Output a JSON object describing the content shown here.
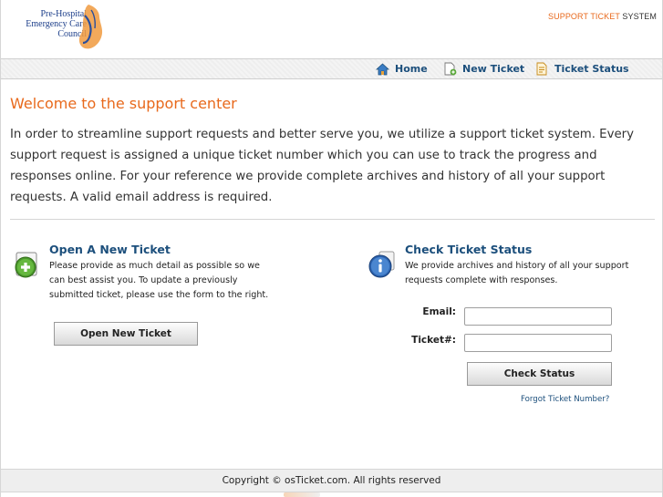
{
  "header": {
    "logo_lines": [
      "Pre-Hospital",
      "Emergency Care",
      "Council"
    ],
    "system_title_accent": "SUPPORT TICKET",
    "system_title_rest": "SYSTEM"
  },
  "nav": {
    "home": "Home",
    "new_ticket": "New Ticket",
    "ticket_status": "Ticket Status"
  },
  "welcome": {
    "title": "Welcome to the support center",
    "body": "In order to streamline support requests and better serve you, we utilize a support ticket system. Every support request is assigned a unique ticket number which you can use to track the progress and responses online. For your reference we provide complete archives and history of all your support requests. A valid email address is required."
  },
  "open_ticket": {
    "title": "Open A New Ticket",
    "text_lines": [
      "Please provide as much detail as possible so we",
      "can best assist you. To update a previously",
      "submitted ticket, please use the form to the right."
    ],
    "button": "Open New Ticket"
  },
  "check_status": {
    "title": "Check Ticket Status",
    "text_lines": [
      "We provide archives and history of all your support",
      "requests complete with responses."
    ],
    "email_label": "Email:",
    "ticket_label": "Ticket#:",
    "button": "Check Status",
    "forgot_link": "Forgot Ticket Number?"
  },
  "footer": {
    "copyright": "Copyright © osTicket.com. All rights reserved"
  },
  "colors": {
    "accent": "#e8691c",
    "link": "#1c4f7c"
  }
}
